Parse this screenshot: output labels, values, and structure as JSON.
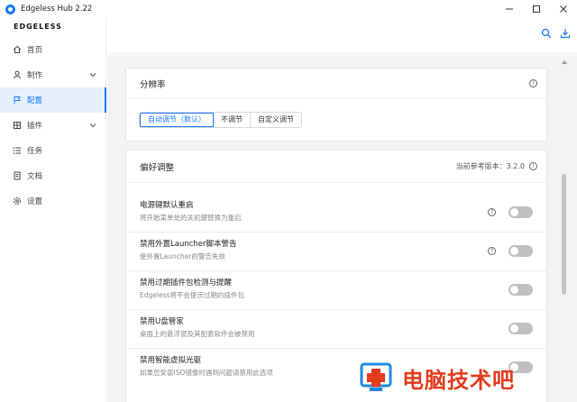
{
  "window": {
    "title": "Edgeless Hub 2.22"
  },
  "brand": "EDGELESS",
  "sidebar": {
    "items": [
      {
        "label": "首页",
        "icon": "home-icon"
      },
      {
        "label": "制作",
        "icon": "user-icon",
        "expandable": true
      },
      {
        "label": "配置",
        "icon": "flag-icon",
        "active": true
      },
      {
        "label": "插件",
        "icon": "grid-icon",
        "expandable": true
      },
      {
        "label": "任务",
        "icon": "list-icon"
      },
      {
        "label": "文档",
        "icon": "document-icon"
      },
      {
        "label": "设置",
        "icon": "gear-icon"
      }
    ]
  },
  "header": {
    "tools": [
      "search-icon",
      "download-icon"
    ]
  },
  "resolution": {
    "title": "分辨率",
    "options": [
      "自动调节（默认）",
      "不调节",
      "自定义调节"
    ],
    "selected": "自动调节（默认）"
  },
  "preferences": {
    "title": "偏好调整",
    "version_text": "当前参考版本：3.2.0",
    "rows": [
      {
        "title": "电源键默认重启",
        "desc": "将开始菜单处的关机键替换为重启",
        "help": true,
        "on": false
      },
      {
        "title": "禁用外置Launcher脚本警告",
        "desc": "使外置Launcher的警告失效",
        "help": true,
        "on": false
      },
      {
        "title": "禁用过期插件包检测与提醒",
        "desc": "Edgeless将不会提示过期的插件包",
        "help": false,
        "on": false
      },
      {
        "title": "禁用U盘管家",
        "desc": "桌面上的悬浮窗及其配套软件会被禁用",
        "help": false,
        "on": false
      },
      {
        "title": "禁用智能虚拟光驱",
        "desc": "如果您安装ISO镜像时遇到问题请禁用此选项",
        "help": false,
        "on": false
      }
    ]
  },
  "watermark": {
    "text": "电脑技术吧"
  },
  "colors": {
    "accent": "#1677ff",
    "toggle_off": "#bfbfbf",
    "watermark": "#e23b1e"
  }
}
